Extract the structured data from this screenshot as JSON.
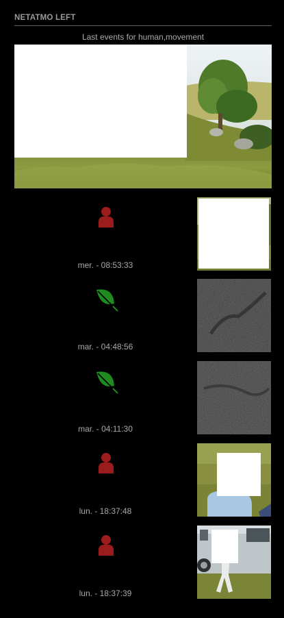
{
  "header": {
    "title": "NETATMO LEFT"
  },
  "subtitle": "Last events for human,movement",
  "colors": {
    "human": "#9b1c1c",
    "movement": "#1f8a1f",
    "background": "#000000"
  },
  "events": [
    {
      "type": "human",
      "icon": "person-icon",
      "time": "mer. - 08:53:33",
      "thumbnail": "grass-scene-redacted"
    },
    {
      "type": "movement",
      "icon": "leaf-icon",
      "time": "mar. - 04:48:56",
      "thumbnail": "gray-texture"
    },
    {
      "type": "movement",
      "icon": "leaf-icon",
      "time": "mar. - 04:11:30",
      "thumbnail": "gray-texture"
    },
    {
      "type": "human",
      "icon": "person-icon",
      "time": "lun. - 18:37:48",
      "thumbnail": "person-redacted"
    },
    {
      "type": "human",
      "icon": "person-icon",
      "time": "lun. - 18:37:39",
      "thumbnail": "van-person-redacted"
    }
  ]
}
